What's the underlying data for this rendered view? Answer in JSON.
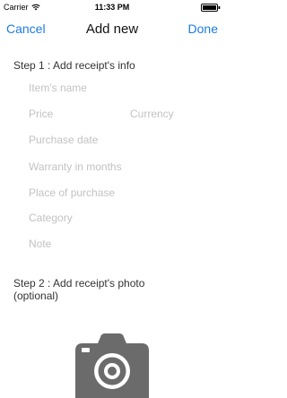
{
  "status_bar": {
    "carrier": "Carrier",
    "time": "11:33 PM"
  },
  "nav": {
    "cancel_label": "Cancel",
    "title": "Add new",
    "done_label": "Done"
  },
  "step1": {
    "heading": "Step 1 : Add receipt's info",
    "fields": {
      "item_name": "Item's name",
      "price": "Price",
      "currency": "Currency",
      "purchase_date": "Purchase date",
      "warranty": "Warranty in months",
      "place": "Place of purchase",
      "category": "Category",
      "note": "Note"
    }
  },
  "step2": {
    "heading_line1": "Step 2 : Add receipt's photo",
    "heading_line2": "(optional)"
  },
  "icons": {
    "camera": "camera-icon",
    "wifi": "wifi-icon",
    "battery": "battery-icon"
  },
  "colors": {
    "accent": "#1e7ce0",
    "placeholder": "#c2c2c2",
    "camera": "#6b6b6b"
  }
}
